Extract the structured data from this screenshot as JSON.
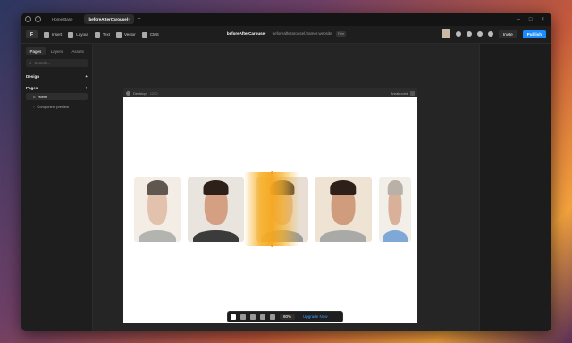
{
  "tabs": {
    "home_label": "Home Base",
    "active_label": "beforeAfterCarousel"
  },
  "toolbar": {
    "logo": "F",
    "items": [
      "Insert",
      "Layout",
      "Text",
      "Vector",
      "CMS"
    ],
    "project_title": "beforeAfterCarousel",
    "url": "beforeafterarousel.framer.website",
    "url_badge": "Free",
    "invite_label": "Invite",
    "publish_label": "Publish"
  },
  "sidebar": {
    "tabs": [
      "Pages",
      "Layers",
      "Assets"
    ],
    "search_placeholder": "Search...",
    "design_label": "Design",
    "pages_label": "Pages",
    "pages": [
      "Home",
      "Component preview"
    ]
  },
  "canvas": {
    "frame_name": "Desktop",
    "frame_width": "1200",
    "breakpoint_label": "Breakpoint",
    "zoom": "80%",
    "upgrade_label": "Upgrade Now"
  },
  "colors": {
    "accent": "#1a8cff",
    "glow": "#f6a61d"
  }
}
